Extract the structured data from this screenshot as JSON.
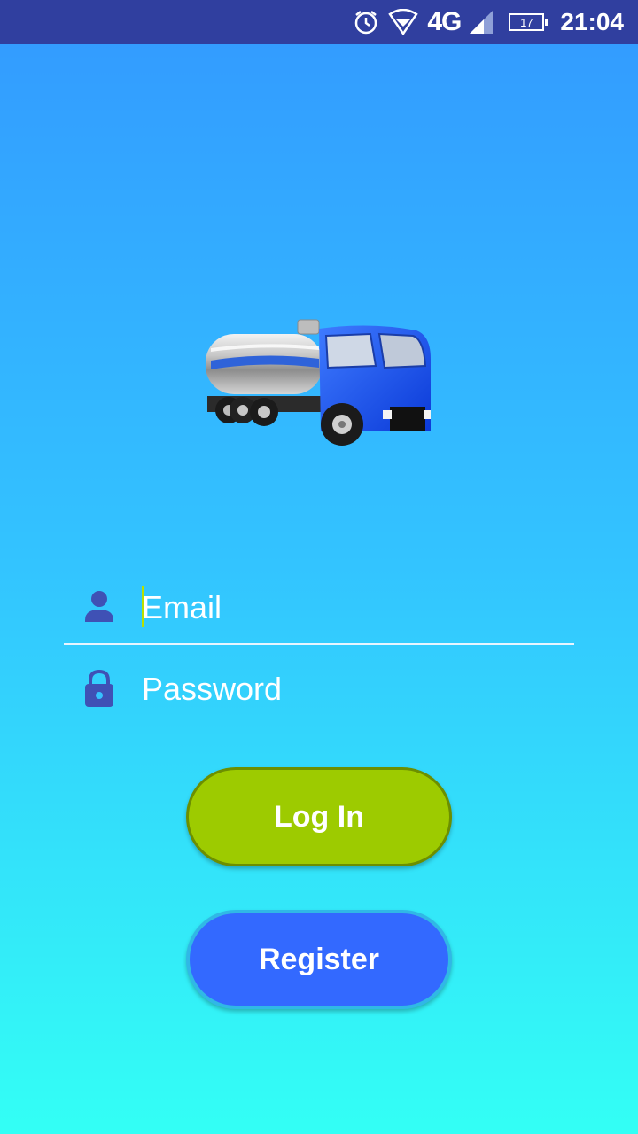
{
  "status_bar": {
    "network": "4G",
    "battery": "17",
    "time": "21:04",
    "icons": [
      "alarm-icon",
      "wifi-icon",
      "signal-icon",
      "battery-icon"
    ]
  },
  "logo": {
    "icon": "tanker-truck-icon"
  },
  "form": {
    "email": {
      "placeholder": "Email",
      "value": "",
      "icon": "person-icon"
    },
    "password": {
      "placeholder": "Password",
      "value": "",
      "icon": "lock-icon"
    }
  },
  "buttons": {
    "login_label": "Log In",
    "register_label": "Register"
  },
  "colors": {
    "status_bar": "#303f9f",
    "gradient_top": "#3399ff",
    "gradient_bottom": "#33fff5",
    "login_button": "#9dcb00",
    "register_button": "#3369ff",
    "icon": "#3f51b5"
  }
}
